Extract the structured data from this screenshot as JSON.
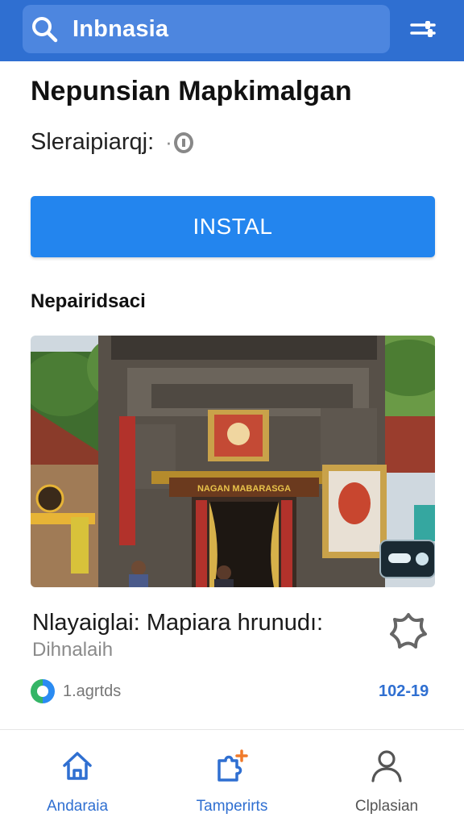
{
  "search": {
    "value": "Inbnasia"
  },
  "header": {
    "title": "Nepunsian Mapkimalgan",
    "subtitle_label": "Sleraipiarqj:",
    "subtitle_value": "·"
  },
  "install": {
    "label": "INSTAL"
  },
  "section": {
    "title": "Nepairidsaci"
  },
  "photo": {
    "sign_text": "NAGAN MABARASGA",
    "alt": "temple-photo"
  },
  "card": {
    "title": "Nlayaiglai: Mapiara hrunudı:",
    "subtitle": "Dihnalaih",
    "meta_text": "1.agrtds",
    "meta_number": "102-19"
  },
  "nav": {
    "items": [
      {
        "label": "Andaraia",
        "icon": "home-icon"
      },
      {
        "label": "Tamperirts",
        "icon": "puzzle-plus-icon"
      },
      {
        "label": "Clplasian",
        "icon": "person-icon"
      }
    ]
  },
  "colors": {
    "primary": "#2f6fd1",
    "button": "#2385ee",
    "accent": "#f07a2a"
  }
}
